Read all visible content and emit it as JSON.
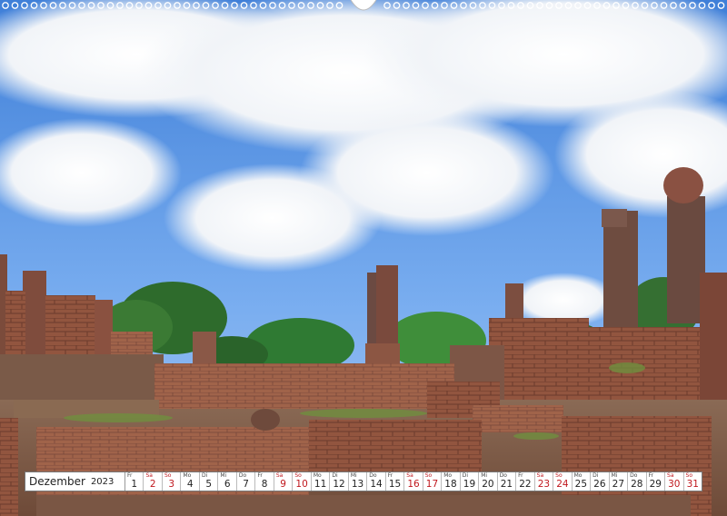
{
  "calendar": {
    "month": "Dezember",
    "year": "2023",
    "days": [
      {
        "wd": "Fr",
        "num": "1",
        "weekend": false
      },
      {
        "wd": "Sa",
        "num": "2",
        "weekend": true
      },
      {
        "wd": "So",
        "num": "3",
        "weekend": true
      },
      {
        "wd": "Mo",
        "num": "4",
        "weekend": false
      },
      {
        "wd": "Di",
        "num": "5",
        "weekend": false
      },
      {
        "wd": "Mi",
        "num": "6",
        "weekend": false
      },
      {
        "wd": "Do",
        "num": "7",
        "weekend": false
      },
      {
        "wd": "Fr",
        "num": "8",
        "weekend": false
      },
      {
        "wd": "Sa",
        "num": "9",
        "weekend": true
      },
      {
        "wd": "So",
        "num": "10",
        "weekend": true
      },
      {
        "wd": "Mo",
        "num": "11",
        "weekend": false
      },
      {
        "wd": "Di",
        "num": "12",
        "weekend": false
      },
      {
        "wd": "Mi",
        "num": "13",
        "weekend": false
      },
      {
        "wd": "Do",
        "num": "14",
        "weekend": false
      },
      {
        "wd": "Fr",
        "num": "15",
        "weekend": false
      },
      {
        "wd": "Sa",
        "num": "16",
        "weekend": true
      },
      {
        "wd": "So",
        "num": "17",
        "weekend": true
      },
      {
        "wd": "Mo",
        "num": "18",
        "weekend": false
      },
      {
        "wd": "Di",
        "num": "19",
        "weekend": false
      },
      {
        "wd": "Mi",
        "num": "20",
        "weekend": false
      },
      {
        "wd": "Do",
        "num": "21",
        "weekend": false
      },
      {
        "wd": "Fr",
        "num": "22",
        "weekend": false
      },
      {
        "wd": "Sa",
        "num": "23",
        "weekend": true
      },
      {
        "wd": "So",
        "num": "24",
        "weekend": true
      },
      {
        "wd": "Mo",
        "num": "25",
        "weekend": false
      },
      {
        "wd": "Di",
        "num": "26",
        "weekend": false
      },
      {
        "wd": "Mi",
        "num": "27",
        "weekend": false
      },
      {
        "wd": "Do",
        "num": "28",
        "weekend": false
      },
      {
        "wd": "Fr",
        "num": "29",
        "weekend": false
      },
      {
        "wd": "Sa",
        "num": "30",
        "weekend": true
      },
      {
        "wd": "So",
        "num": "31",
        "weekend": true
      }
    ]
  },
  "colors": {
    "weekend": "#c0181e",
    "sky": "#4f8ee0",
    "brick": "#9a5a44"
  }
}
